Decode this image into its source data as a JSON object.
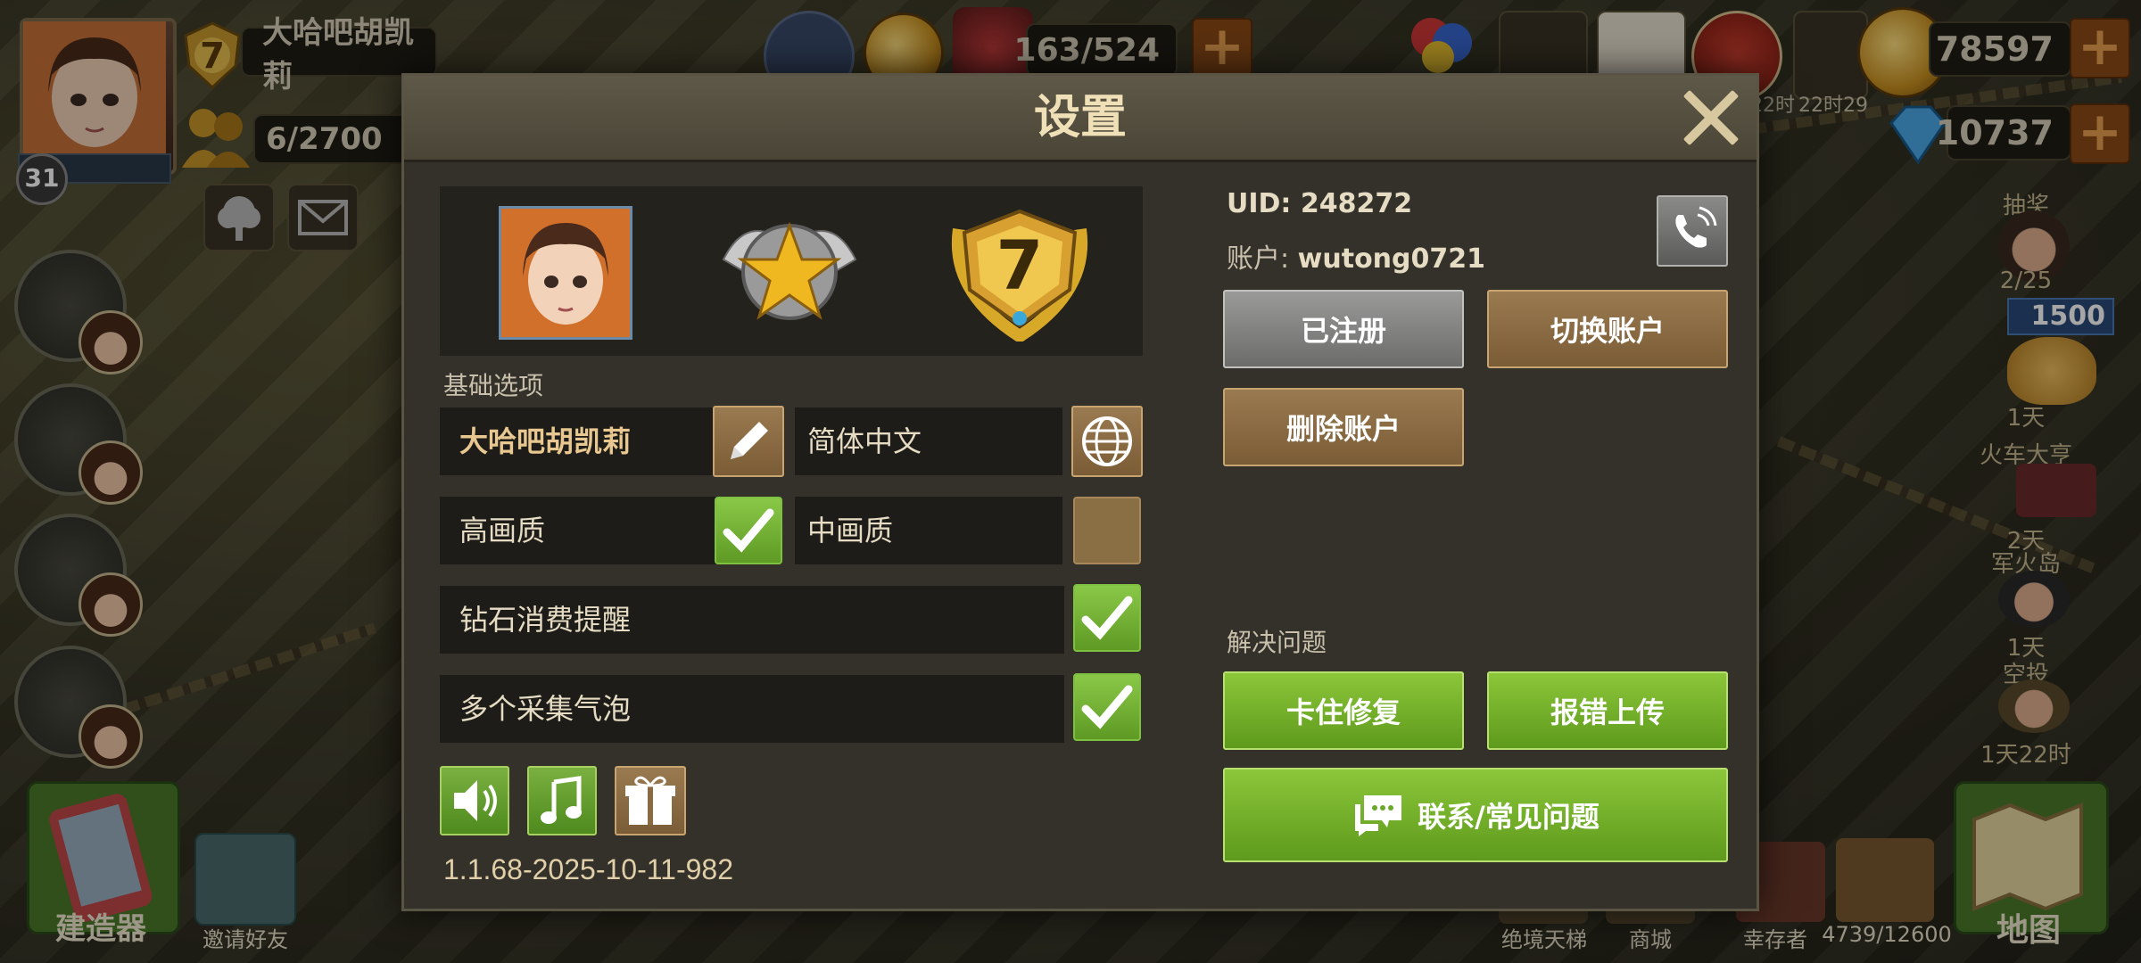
{
  "hud": {
    "player_level": "31",
    "player_name": "大哈吧胡凯莉",
    "rank_level": "7",
    "population": "6/2700",
    "energy": "163/524",
    "gold": "78597",
    "diamonds": "10737",
    "timer_1": "22时",
    "timer_2": "22时29",
    "right_rail": [
      {
        "label": "抽奖",
        "value": "2/25"
      },
      {
        "label": "",
        "value": "1500"
      },
      {
        "label": "",
        "value": "1天"
      },
      {
        "label": "火车大亨",
        "value": "2天"
      },
      {
        "label": "军火岛",
        "value": "1天"
      },
      {
        "label": "空投",
        "value": "1天22时"
      }
    ],
    "bottom_left": [
      {
        "label": "建造器"
      },
      {
        "label": "邀请好友"
      }
    ],
    "bottom_right": [
      {
        "label": "绝境天梯"
      },
      {
        "label": "商城"
      },
      {
        "label": "幸存者"
      },
      {
        "label": "4739/12600"
      },
      {
        "label": "地图"
      }
    ]
  },
  "dialog": {
    "title": "设置",
    "basic_section_label": "基础选项",
    "name_value": "大哈吧胡凯莉",
    "language_value": "简体中文",
    "high_quality_label": "高画质",
    "high_quality_checked": true,
    "mid_quality_label": "中画质",
    "mid_quality_checked": false,
    "diamond_reminder_label": "钻石消费提醒",
    "diamond_reminder_checked": true,
    "collect_bubbles_label": "多个采集气泡",
    "collect_bubbles_checked": true,
    "version": "1.1.68-2025-10-11-982",
    "badge_rank": "7",
    "uid_label": "UID:",
    "uid_value": "248272",
    "account_label": "账户:",
    "account_value": "wutong0721",
    "registered_button": "已注册",
    "switch_account_button": "切换账户",
    "delete_account_button": "删除账户",
    "solve_section_label": "解决问题",
    "stuck_fix_button": "卡住修复",
    "report_upload_button": "报错上传",
    "contact_faq_button": "联系/常见问题"
  },
  "colors": {
    "accent_green": "#7ab040",
    "brown_button": "#8a6a42",
    "dialog_bg": "#33312a"
  }
}
